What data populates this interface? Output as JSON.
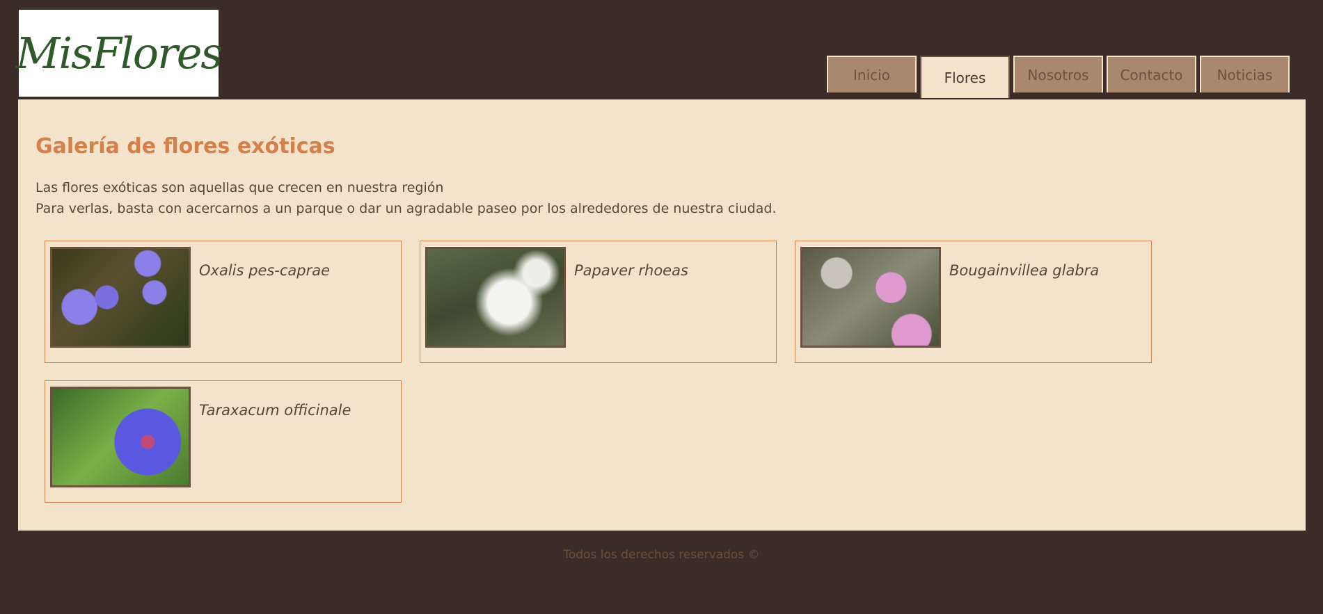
{
  "logo": {
    "text": "MisFlores"
  },
  "nav": {
    "tabs": [
      {
        "label": "Inicio",
        "active": false
      },
      {
        "label": "Flores",
        "active": true
      },
      {
        "label": "Nosotros",
        "active": false
      },
      {
        "label": "Contacto",
        "active": false
      },
      {
        "label": "Noticias",
        "active": false
      }
    ]
  },
  "main": {
    "title": "Galería de flores exóticas",
    "intro": [
      "Las flores exóticas son aquellas que crecen en nuestra región",
      "Para verlas, basta con acercarnos a un parque o dar un agradable paseo por los alrededores de nuestra ciudad."
    ],
    "flowers": [
      {
        "name": "Oxalis pes-caprae"
      },
      {
        "name": "Papaver rhoeas"
      },
      {
        "name": "Bougainvillea glabra"
      },
      {
        "name": "Taraxacum officinale"
      }
    ]
  },
  "footer": {
    "text": "Todos los derechos reservados ©"
  }
}
